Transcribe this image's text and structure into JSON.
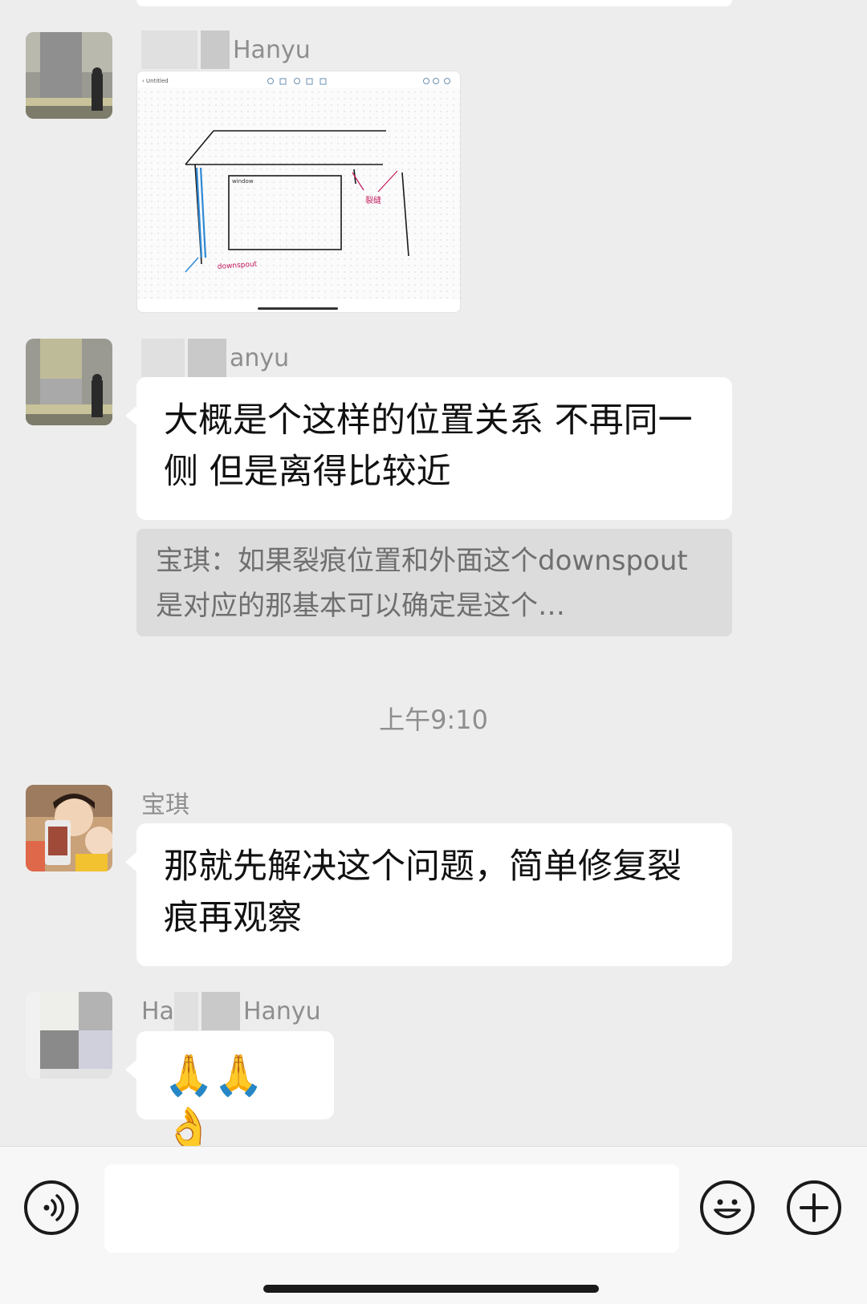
{
  "messages": [
    {
      "sender": "Hanyu",
      "type": "image"
    },
    {
      "sender": "anyu",
      "type": "text",
      "text": "大概是个这样的位置关系 不再同一侧 但是离得比较近"
    },
    {
      "type": "quote",
      "text": "宝琪：如果裂痕位置和外面这个downspout是对应的那基本可以确定是这个…"
    },
    {
      "type": "timestamp",
      "text": "上午9:10"
    },
    {
      "sender": "宝琪",
      "type": "text",
      "text": "那就先解决这个问题，简单修复裂痕再观察"
    },
    {
      "sender": "Hanyu",
      "sender_prefix": "Ha",
      "type": "text",
      "text": "🙏🙏👌"
    }
  ],
  "image_annotations": {
    "window_label": "window",
    "downspout_label": "downspout",
    "crack_label": "裂缝"
  },
  "input_bar": {
    "voice_icon": "voice-icon",
    "emoji_icon": "emoji-icon",
    "plus_icon": "plus-icon",
    "placeholder": ""
  },
  "colors": {
    "background": "#ededed",
    "bubble": "#ffffff",
    "quote_bg": "#dcdcdc",
    "meta_text": "#8e8e8e"
  }
}
